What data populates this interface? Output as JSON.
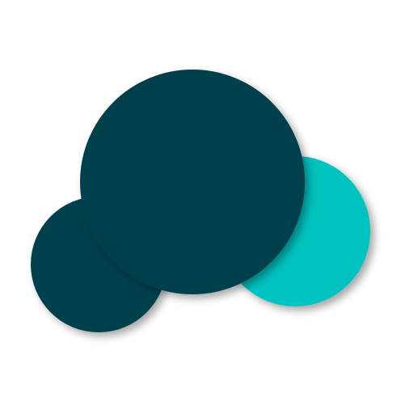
{
  "logo": {
    "icon": "cloud-icon",
    "colors": {
      "background": "#ffffff",
      "dark_teal": "#05404e",
      "bright_teal": "#00c2bf",
      "shadow": "#000000"
    }
  }
}
